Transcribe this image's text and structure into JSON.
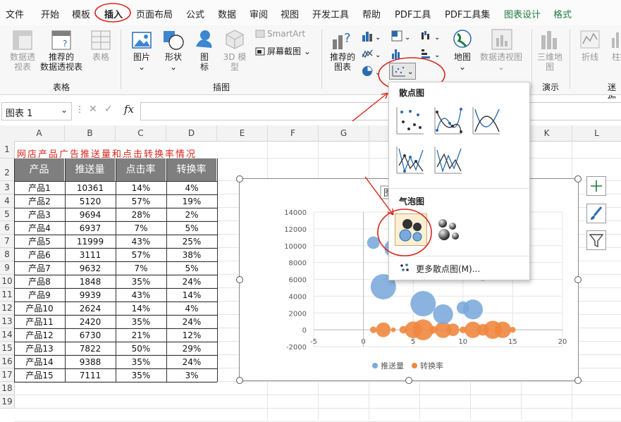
{
  "menu": {
    "items": [
      "文件",
      "开始",
      "模板",
      "插入",
      "页面布局",
      "公式",
      "数据",
      "审阅",
      "视图",
      "开发工具",
      "帮助",
      "PDF工具",
      "PDF工具集",
      "图表设计",
      "格式"
    ],
    "active": "插入"
  },
  "ribbon": {
    "table_group": {
      "label": "表格",
      "pivot": "数据透\n视表",
      "pivot_rec": "推荐的\n数据透视表",
      "table": "表格"
    },
    "illustrations_group": {
      "label": "插图",
      "pictures": "图片",
      "shapes": "形状",
      "icons": "图\n标",
      "model3d": "3D 模\n型",
      "smartart": "SmartArt",
      "screenshot": "屏幕截图"
    },
    "charts_group": {
      "rec_charts": "推荐的\n图表",
      "maps": "地图",
      "pivot_chart": "数据透视图"
    },
    "tours_group": {
      "label": "演示",
      "map3d": "三维地\n图"
    },
    "sparklines_group": {
      "label": "迷你",
      "line": "折线",
      "column": "柱"
    }
  },
  "formula_bar": {
    "name_box": "图表 1",
    "fx": "fx",
    "cancel": "✕",
    "enter": "✓"
  },
  "columns": [
    "A",
    "B",
    "C",
    "D",
    "E",
    "F",
    "G",
    "H",
    "I",
    "J",
    "K",
    "L"
  ],
  "rows": [
    "1",
    "2",
    "3",
    "4",
    "5",
    "6",
    "7",
    "8",
    "9",
    "10",
    "11",
    "12",
    "13",
    "14",
    "15",
    "16",
    "17",
    "18",
    "19"
  ],
  "sheet": {
    "title": "网店产品广告推送量和点击转换率情况",
    "headers": [
      "产品",
      "推送量",
      "点击率",
      "转换率"
    ],
    "data": [
      [
        "产品1",
        "10361",
        "14%",
        "4%"
      ],
      [
        "产品2",
        "5120",
        "57%",
        "19%"
      ],
      [
        "产品3",
        "9694",
        "28%",
        "2%"
      ],
      [
        "产品4",
        "6937",
        "7%",
        "5%"
      ],
      [
        "产品5",
        "11999",
        "43%",
        "25%"
      ],
      [
        "产品6",
        "3111",
        "57%",
        "38%"
      ],
      [
        "产品7",
        "9632",
        "7%",
        "5%"
      ],
      [
        "产品8",
        "1848",
        "35%",
        "24%"
      ],
      [
        "产品9",
        "9939",
        "43%",
        "14%"
      ],
      [
        "产品10",
        "2624",
        "14%",
        "4%"
      ],
      [
        "产品11",
        "2420",
        "35%",
        "24%"
      ],
      [
        "产品12",
        "6730",
        "21%",
        "12%"
      ],
      [
        "产品13",
        "7822",
        "50%",
        "29%"
      ],
      [
        "产品14",
        "9388",
        "35%",
        "24%"
      ],
      [
        "产品15",
        "7111",
        "35%",
        "3%"
      ]
    ]
  },
  "chart_data": {
    "type": "scatter",
    "title": "图",
    "xlim": [
      -5,
      20
    ],
    "ylim": [
      -2000,
      14000
    ],
    "x_ticks": [
      "-5",
      "0",
      "5",
      "10",
      "15",
      "20"
    ],
    "y_ticks": [
      "14000",
      "12000",
      "10000",
      "8000",
      "6000",
      "4000",
      "2000",
      "0",
      "-2000"
    ],
    "grid": true,
    "legend_position": "bottom",
    "series": [
      {
        "name": "推送量",
        "color": "#7aa9dc",
        "bubble": true,
        "x": [
          1,
          2,
          3,
          4,
          5,
          6,
          7,
          8,
          9,
          10,
          11,
          12,
          13,
          14,
          15
        ],
        "y": [
          10361,
          5120,
          9694,
          6937,
          11999,
          3111,
          9632,
          1848,
          9939,
          2624,
          2420,
          6730,
          7822,
          9388,
          7111
        ],
        "size": [
          14,
          57,
          28,
          7,
          43,
          57,
          7,
          35,
          43,
          14,
          35,
          21,
          50,
          35,
          35
        ]
      },
      {
        "name": "转换率",
        "color": "#f0873f",
        "bubble": true,
        "x": [
          1,
          2,
          3,
          4,
          5,
          6,
          7,
          8,
          9,
          10,
          11,
          12,
          13,
          14,
          15
        ],
        "y": [
          0,
          0,
          0,
          0,
          0,
          0,
          0,
          0,
          0,
          0,
          0,
          0,
          0,
          0,
          0
        ],
        "size": [
          4,
          19,
          2,
          5,
          25,
          38,
          5,
          24,
          14,
          4,
          24,
          12,
          29,
          24,
          3
        ]
      }
    ]
  },
  "dropdown": {
    "scatter_title": "散点图",
    "bubble_title": "气泡图",
    "more": "更多散点图(M)..."
  },
  "colors": {
    "annotation_red": "#d9261c",
    "active_tab_green": "#1e7a3d",
    "series1": "#7aa9dc",
    "series2": "#f0873f",
    "header_gray": "#7f7f7f"
  }
}
